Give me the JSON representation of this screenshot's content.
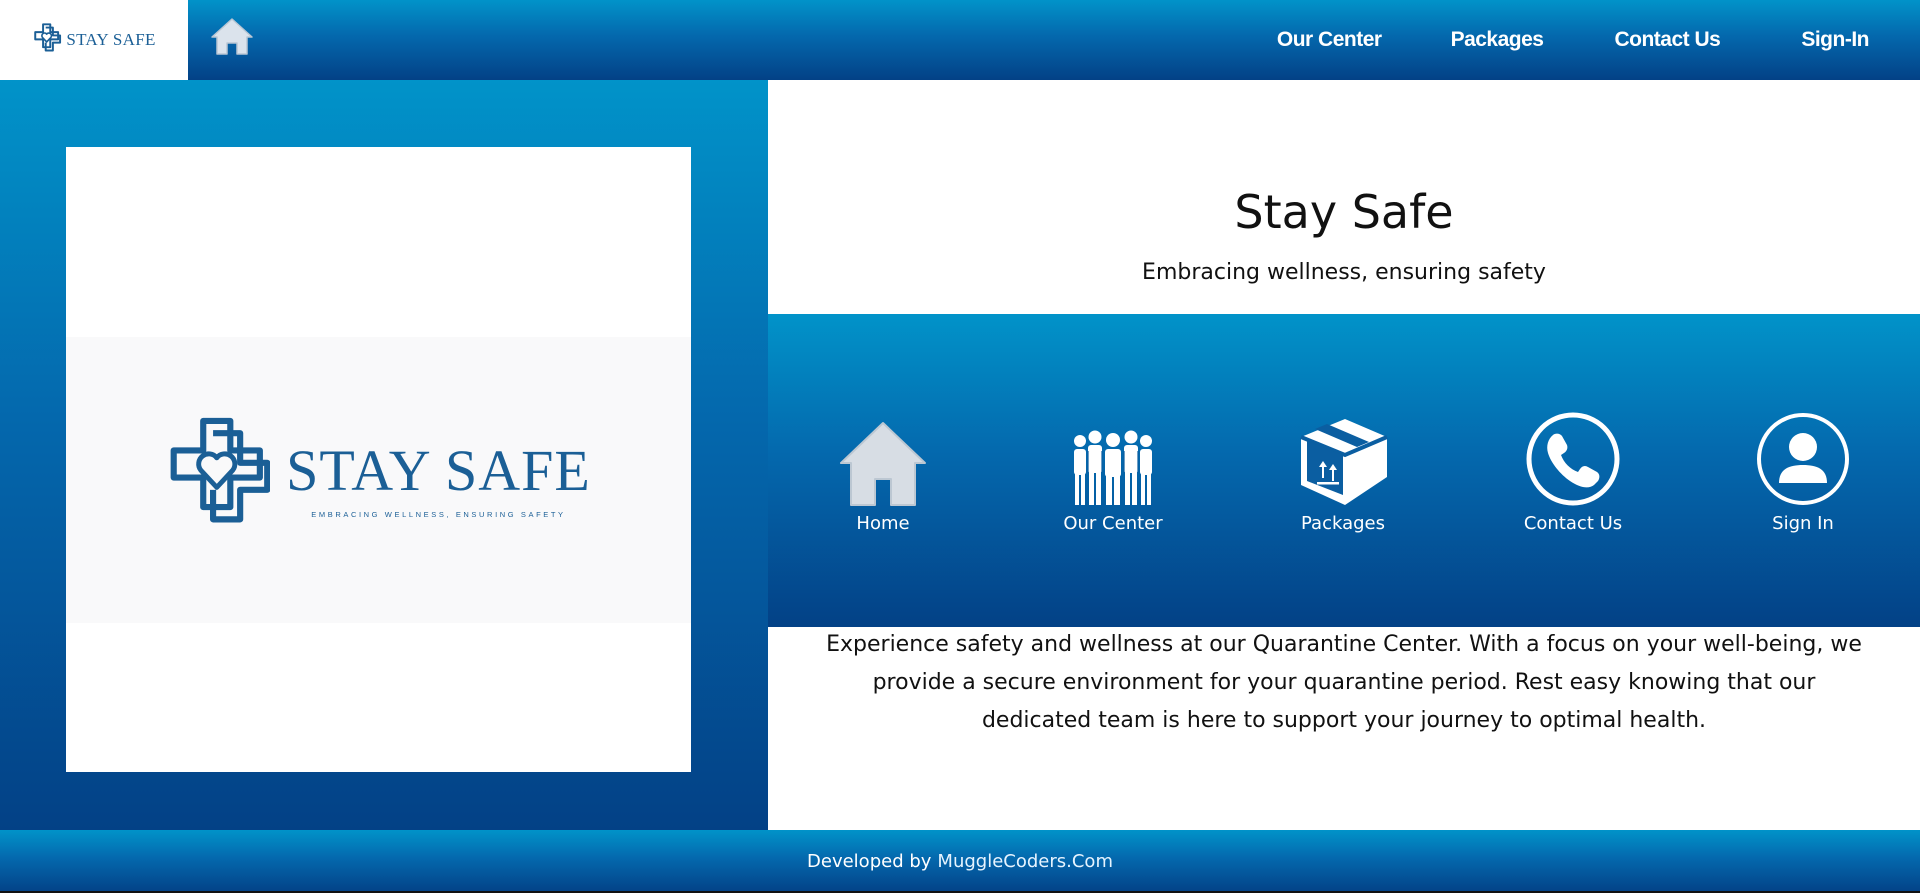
{
  "header": {
    "brand_wordmark": "STAY SAFE",
    "nav": [
      {
        "label": "Our Center"
      },
      {
        "label": "Packages"
      },
      {
        "label": "Contact Us"
      },
      {
        "label": "Sign-In"
      }
    ],
    "icons": {
      "brand": "cross-heart-logo-icon",
      "home": "home-icon"
    }
  },
  "logo_panel": {
    "wordmark": "STAY SAFE",
    "tagline": "EMBRACING WELLNESS, ENSURING SAFETY",
    "icon": "cross-heart-logo-icon"
  },
  "hero": {
    "title": "Stay Safe",
    "subtitle": "Embracing wellness, ensuring safety"
  },
  "quick_links": [
    {
      "label": "Home",
      "icon": "home-icon"
    },
    {
      "label": "Our Center",
      "icon": "people-group-icon"
    },
    {
      "label": "Packages",
      "icon": "package-box-icon"
    },
    {
      "label": "Contact Us",
      "icon": "phone-icon"
    },
    {
      "label": "Sign In",
      "icon": "user-icon"
    }
  ],
  "description": "Experience safety and wellness at our Quarantine Center. With a focus on your well-being, we provide a secure environment for your quarantine period. Rest easy knowing that our dedicated team is here to support your journey to optimal health.",
  "footer": {
    "prefix": "Developed by",
    "link": "MuggleCoders.Com"
  },
  "colors": {
    "gradient_top": "#0193c9",
    "gradient_bottom": "#034186",
    "brand_blue": "#1b5f96",
    "icon_fill": "#d7dde4"
  }
}
